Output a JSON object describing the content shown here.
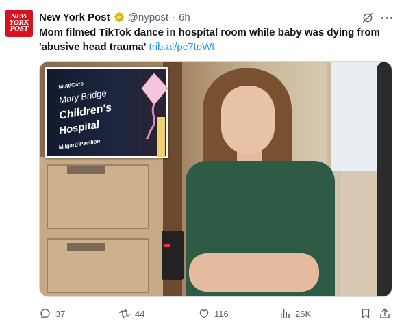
{
  "author": {
    "avatar_lines": [
      "NEW",
      "YORK",
      "POST"
    ],
    "display_name": "New York Post",
    "handle": "@nypost",
    "separator": "·",
    "time": "6h"
  },
  "tweet": {
    "text": "Mom filmed TikTok dance in hospital room while baby was dying from 'abusive head trauma'",
    "link": "trib.al/pc7toWt"
  },
  "media": {
    "inset_sign": {
      "line1": "MultiCare",
      "line2": "Mary Bridge",
      "line3": "Children's",
      "line4": "Hospital",
      "line5": "Milgard Pavilion"
    }
  },
  "actions": {
    "replies": "37",
    "reposts": "44",
    "likes": "116",
    "views": "26K"
  },
  "colors": {
    "text": "#0f1419",
    "secondary": "#536471",
    "link": "#1d9bf0",
    "verified": "#e2b719",
    "brand_red": "#d8111f"
  },
  "icons": {
    "verified": "verified-badge-icon",
    "grok": "grok-icon",
    "more": "more-icon",
    "reply": "reply-icon",
    "repost": "repost-icon",
    "like": "like-icon",
    "views": "views-icon",
    "bookmark": "bookmark-icon",
    "share": "share-icon"
  }
}
